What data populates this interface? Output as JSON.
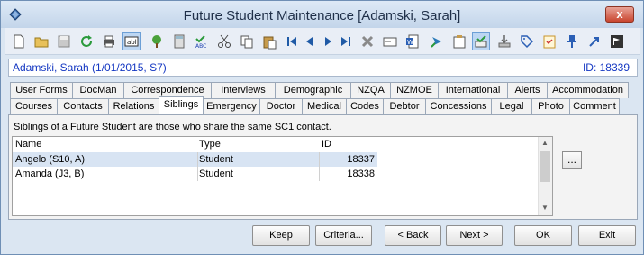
{
  "window": {
    "title": "Future Student Maintenance  [Adamski, Sarah]",
    "close_label": "x"
  },
  "toolbar": {
    "icons": [
      "new-document-icon",
      "open-folder-icon",
      "save-icon",
      "refresh-icon",
      "print-icon",
      "text-field-icon",
      "tree-icon",
      "calculator-icon",
      "spellcheck-icon",
      "cut-icon",
      "copy-icon",
      "paste-icon",
      "first-record-icon",
      "previous-record-icon",
      "next-record-icon",
      "last-record-icon",
      "delete-icon",
      "card-icon",
      "word-export-icon",
      "forward-icon",
      "clipboard-icon",
      "approve-icon",
      "download-icon",
      "tag-icon",
      "checklist-icon",
      "pin-icon",
      "arrow-icon",
      "flag-icon"
    ],
    "active_icons": [
      "text-field-icon",
      "approve-icon"
    ]
  },
  "header": {
    "student": "Adamski, Sarah (1/01/2015, S7)",
    "id_label": "ID: 18339"
  },
  "tabs_row1": [
    "User Forms",
    "DocMan",
    "Correspondence",
    "Interviews",
    "Demographic",
    "NZQA",
    "NZMOE",
    "International",
    "Alerts",
    "Accommodation"
  ],
  "tabs_row2": [
    "Courses",
    "Contacts",
    "Relations",
    "Siblings",
    "Emergency",
    "Doctor",
    "Medical",
    "Codes",
    "Debtor",
    "Concessions",
    "Legal",
    "Photo",
    "Comment"
  ],
  "active_tab": "Siblings",
  "info_text": "Siblings of a Future Student are those who share the same SC1 contact.",
  "grid": {
    "columns": [
      "Name",
      "Type",
      "ID"
    ],
    "rows": [
      {
        "name": "Angelo (S10, A)",
        "type": "Student",
        "id": "18337"
      },
      {
        "name": "Amanda (J3, B)",
        "type": "Student",
        "id": "18338"
      }
    ]
  },
  "ellipsis_label": "...",
  "buttons": {
    "keep": "Keep",
    "criteria": "Criteria...",
    "back": "< Back",
    "next": "Next >",
    "ok": "OK",
    "exit": "Exit"
  }
}
